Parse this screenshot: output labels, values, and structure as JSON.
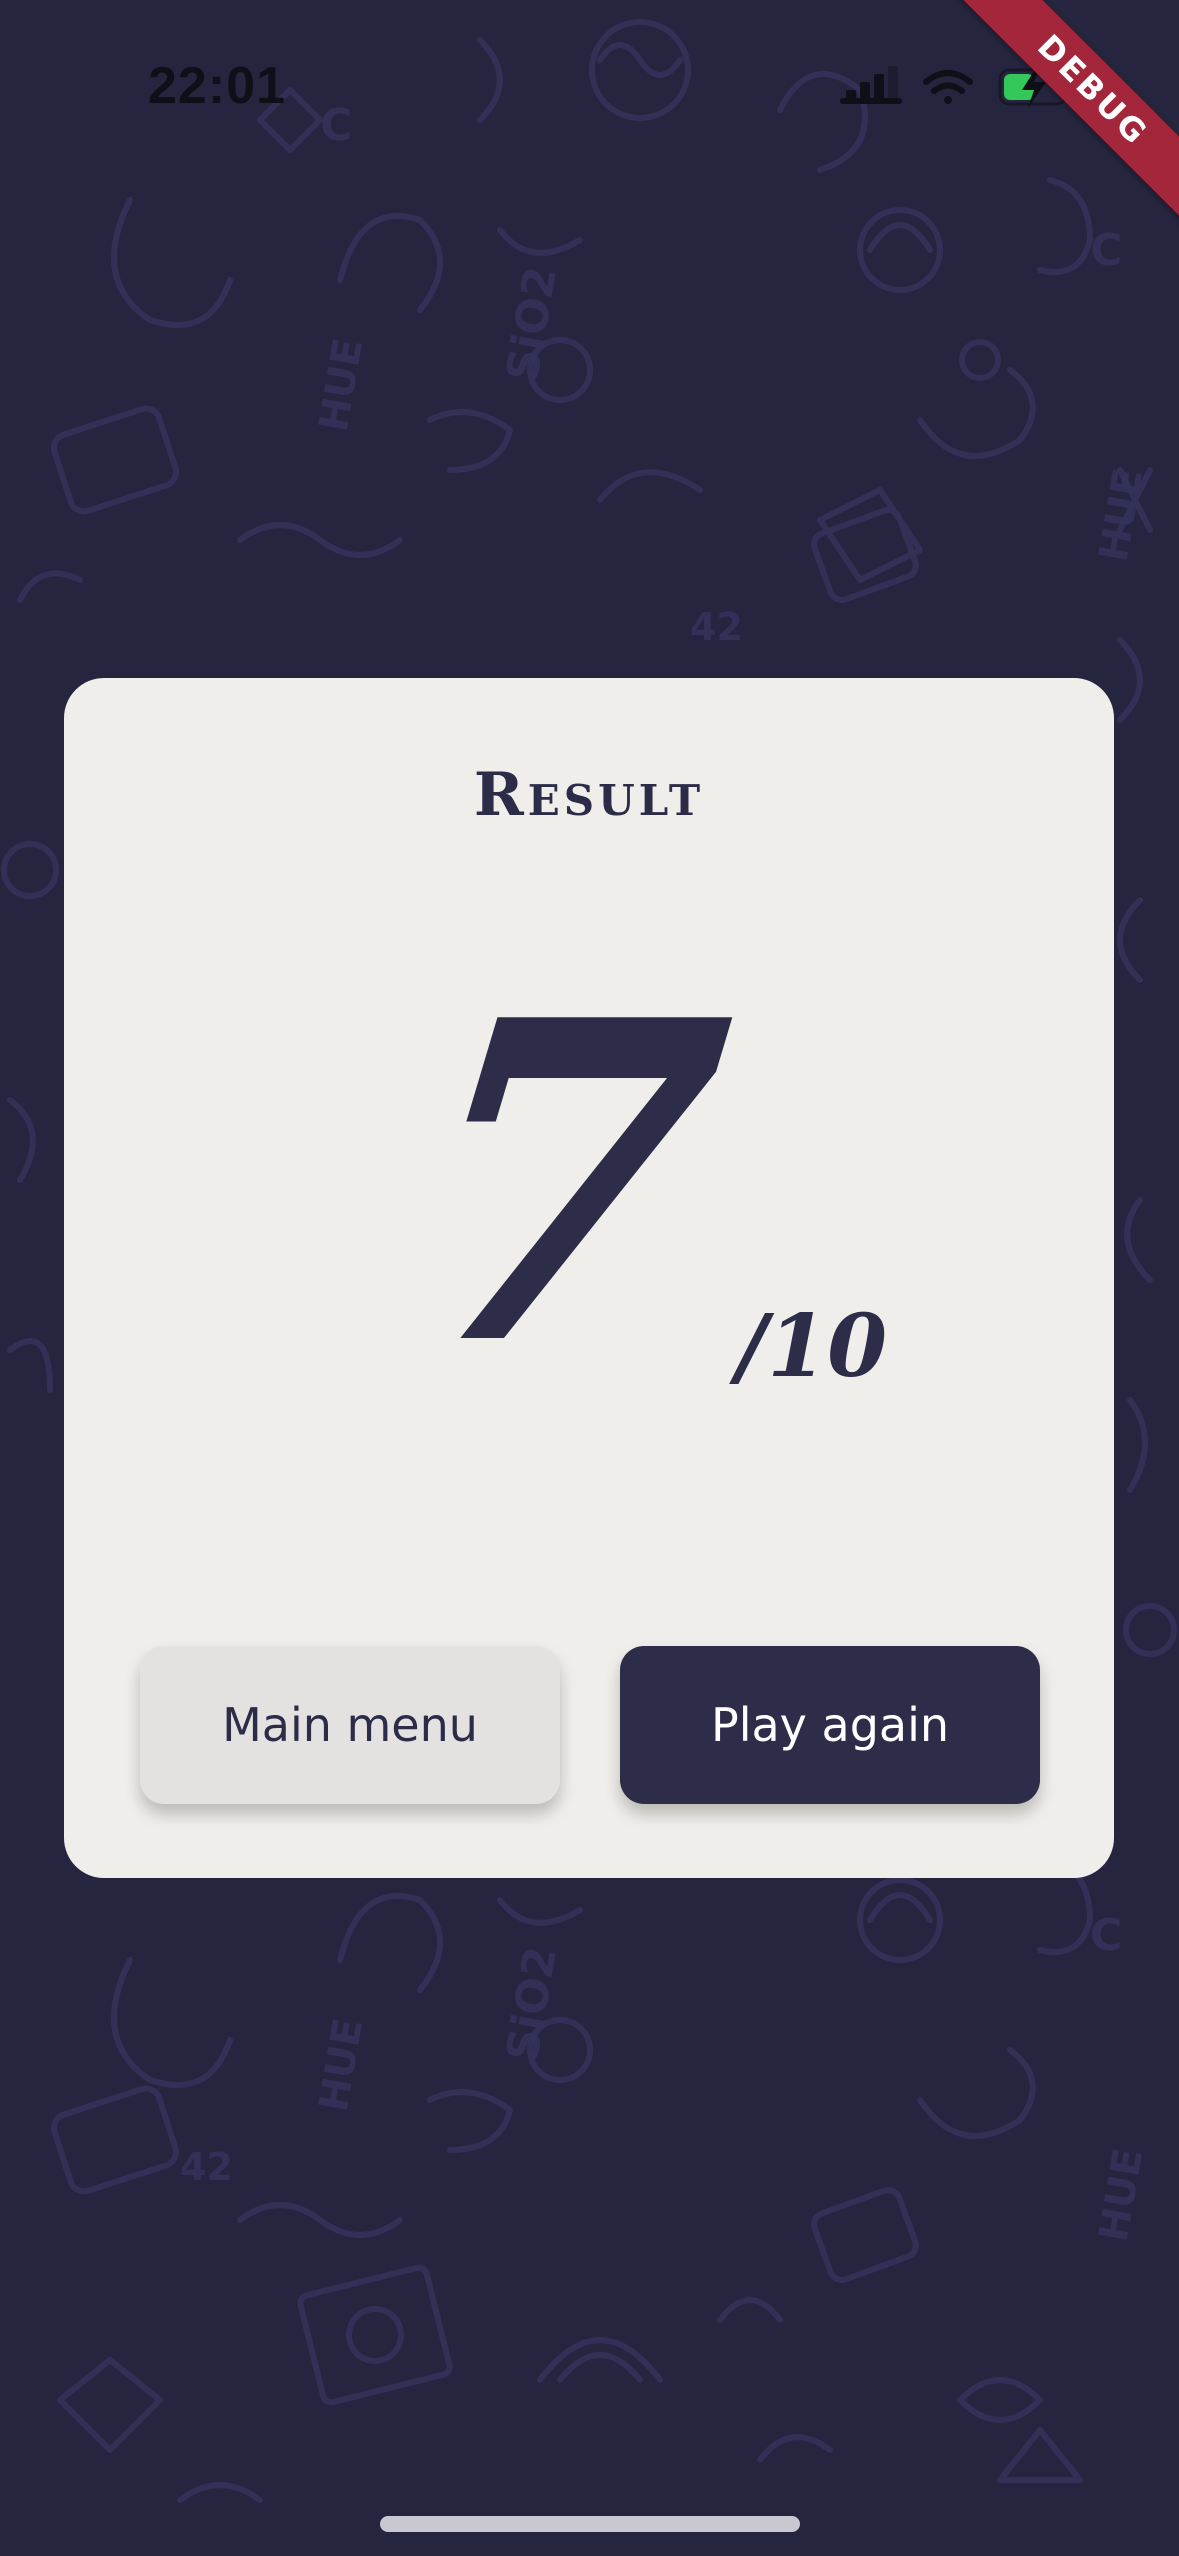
{
  "status_bar": {
    "time": "22:01",
    "icons": [
      "cellular-icon",
      "wifi-icon",
      "battery-charging-icon"
    ]
  },
  "debug_banner": {
    "label": "DEBUG",
    "color": "#a3263a"
  },
  "result_card": {
    "title": "Result",
    "score": "7",
    "score_max": "/10",
    "buttons": {
      "main_menu": "Main menu",
      "play_again": "Play again"
    }
  },
  "colors": {
    "background": "#26253f",
    "card": "#f0eeea",
    "primary": "#2d2c49",
    "secondary_button": "#e4e2e0"
  }
}
